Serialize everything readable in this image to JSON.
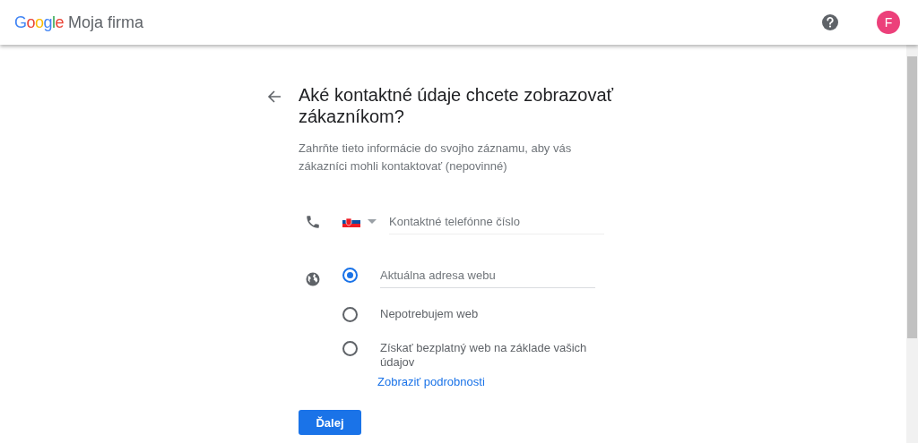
{
  "header": {
    "logo": "Google",
    "product": "Moja firma",
    "avatar_letter": "F"
  },
  "title": "Aké kontaktné údaje chcete zobrazovať zákazníkom?",
  "subtitle": "Zahrňte tieto informácie do svojho záznamu, aby vás zákazníci mohli kontaktovať (nepovinné)",
  "phone": {
    "placeholder": "Kontaktné telefónne číslo"
  },
  "website_options": [
    {
      "kind": "input",
      "placeholder": "Aktuálna adresa webu",
      "selected": true
    },
    {
      "kind": "label",
      "label": "Nepotrebujem web",
      "selected": false
    },
    {
      "kind": "label",
      "label": "Získať bezplatný web na základe vašich údajov",
      "link": "Zobraziť podrobnosti",
      "selected": false
    }
  ],
  "next_button": "Ďalej"
}
